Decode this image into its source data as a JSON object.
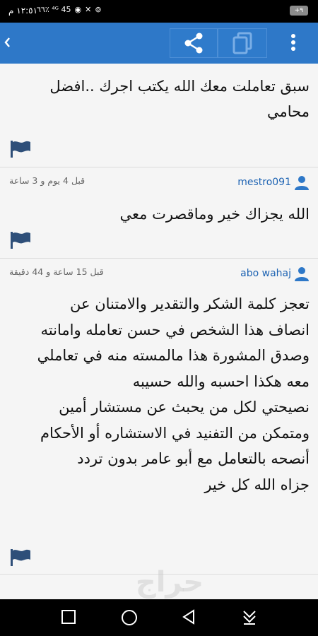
{
  "status_bar": {
    "time": "١٢:٥١ م",
    "battery": "+٩",
    "indicators": "٦٦٪ ⁴ᴳ 45"
  },
  "app_bar": {
    "back_icon": "chevron-left-icon",
    "share_icon": "share-icon",
    "copy_icon": "copy-icon",
    "more_icon": "more-vertical-icon",
    "color": "#2e78c8"
  },
  "posts": [
    {
      "body": "سبق تعاملت معك الله يكتب اجرك ..افضل\nمحامي",
      "flag_icon": "flag-icon"
    },
    {
      "author": "mestro091",
      "time_ago": "قبل 4 يوم و 3 ساعة",
      "body": "الله يجزاك خير وماقصرت معي",
      "flag_icon": "flag-icon"
    },
    {
      "author": "abo wahaj",
      "time_ago": "قبل 15 ساعة و 44 دقيقة",
      "body": "تعجز كلمة الشكر والتقدير والامتنان عن\nانصاف هذا الشخص في حسن تعامله وامانته\nوصدق المشورة هذا مالمسته منه في تعاملي\nمعه هكذا احسبه والله حسيبه\nنصيحتي لكل من يحبث عن مستشار أمين\nومتمكن من التفنيد في الاستشاره أو الأحكام\nأنصحه بالتعامل مع أبو عامر بدون تردد\nجزاه الله كل خير",
      "flag_icon": "flag-icon"
    }
  ],
  "watermark": "حراج",
  "nav_bar": {
    "recents_icon": "square-icon",
    "home_icon": "circle-icon",
    "back_icon": "triangle-back-icon",
    "notifications_icon": "download-arrow-icon"
  }
}
